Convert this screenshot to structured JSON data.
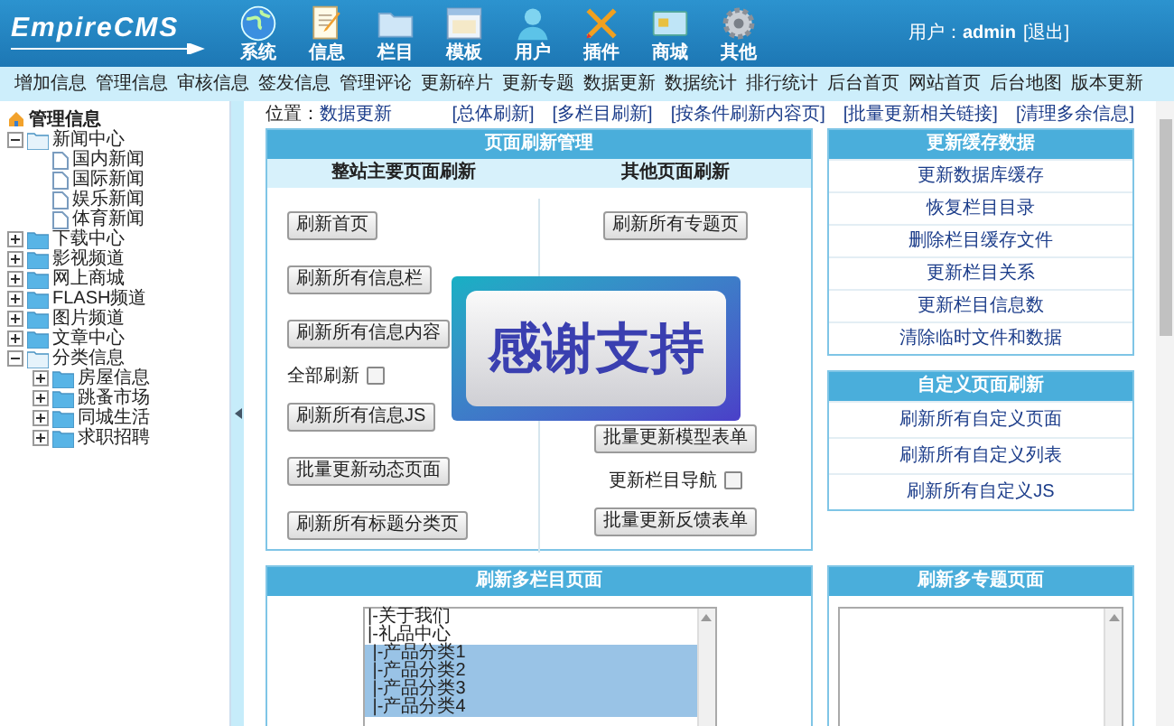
{
  "header": {
    "logo": "EmpireCMS",
    "modules": [
      {
        "label": "系统"
      },
      {
        "label": "信息"
      },
      {
        "label": "栏目"
      },
      {
        "label": "模板"
      },
      {
        "label": "用户"
      },
      {
        "label": "插件"
      },
      {
        "label": "商城"
      },
      {
        "label": "其他"
      }
    ],
    "user_text": "用户：**admin**",
    "logout": "[退出]"
  },
  "nav": [
    "增加信息",
    "管理信息",
    "审核信息",
    "签发信息",
    "管理评论",
    "更新碎片",
    "更新专题",
    "数据更新",
    "数据统计",
    "排行统计",
    "后台首页",
    "网站首页",
    "后台地图",
    "版本更新"
  ],
  "tree": {
    "title": "管理信息",
    "items": [
      {
        "label": "新闻中心",
        "kind": "folder",
        "expanded": true,
        "children": [
          {
            "label": "国内新闻",
            "kind": "page"
          },
          {
            "label": "国际新闻",
            "kind": "page"
          },
          {
            "label": "娱乐新闻",
            "kind": "page"
          },
          {
            "label": "体育新闻",
            "kind": "page"
          }
        ]
      },
      {
        "label": "下载中心",
        "kind": "folder",
        "expanded": false
      },
      {
        "label": "影视频道",
        "kind": "folder",
        "expanded": false
      },
      {
        "label": "网上商城",
        "kind": "folder",
        "expanded": false
      },
      {
        "label": "FLASH频道",
        "kind": "folder",
        "expanded": false
      },
      {
        "label": "图片频道",
        "kind": "folder",
        "expanded": false
      },
      {
        "label": "文章中心",
        "kind": "folder",
        "expanded": false
      },
      {
        "label": "分类信息",
        "kind": "folder",
        "expanded": true,
        "children": [
          {
            "label": "房屋信息",
            "kind": "folder",
            "expanded": false
          },
          {
            "label": "跳蚤市场",
            "kind": "folder",
            "expanded": false
          },
          {
            "label": "同城生活",
            "kind": "folder",
            "expanded": false
          },
          {
            "label": "求职招聘",
            "kind": "folder",
            "expanded": false
          }
        ]
      }
    ]
  },
  "breadcrumb": {
    "label": "位置：",
    "link": "数据更新"
  },
  "quick_links": [
    "[总体刷新]",
    "[多栏目刷新]",
    "[按条件刷新内容页]",
    "[批量更新相关链接]",
    "[清理多余信息]"
  ],
  "refresh_panel": {
    "title": "页面刷新管理",
    "columns": [
      {
        "heading": "整站主要页面刷新",
        "items": [
          {
            "kind": "button",
            "label": "刷新首页"
          },
          {
            "kind": "button",
            "label": "刷新所有信息栏"
          },
          {
            "kind": "button",
            "label": "刷新所有信息内容"
          },
          {
            "kind": "checkbox",
            "label": "全部刷新",
            "checked": false
          },
          {
            "kind": "button",
            "label": "刷新所有信息JS"
          },
          {
            "kind": "button",
            "label": "批量更新动态页面"
          },
          {
            "kind": "button",
            "label": "刷新所有标题分类页"
          }
        ]
      },
      {
        "heading": "其他页面刷新",
        "items": [
          {
            "kind": "button",
            "label": "刷新所有专题页"
          },
          {
            "kind": "covered"
          },
          {
            "kind": "button",
            "label": "批量更新模型表单"
          },
          {
            "kind": "checkbox",
            "label": "更新栏目导航",
            "checked": false
          },
          {
            "kind": "button",
            "label": "批量更新反馈表单"
          }
        ]
      }
    ]
  },
  "cache_panel": {
    "title": "更新缓存数据",
    "links": [
      "更新数据库缓存",
      "恢复栏目目录",
      "删除栏目缓存文件",
      "更新栏目关系",
      "更新栏目信息数",
      "清除临时文件和数据"
    ]
  },
  "custom_panel": {
    "title": "自定义页面刷新",
    "links": [
      "刷新所有自定义页面",
      "刷新所有自定义列表",
      "刷新所有自定义JS"
    ]
  },
  "multi_column_panel": {
    "title": "刷新多栏目页面",
    "options": [
      {
        "label": "|-关于我们",
        "selected": false
      },
      {
        "label": "|-礼品中心",
        "selected": false
      },
      {
        "label": " |-产品分类1",
        "selected": true
      },
      {
        "label": " |-产品分类2",
        "selected": true
      },
      {
        "label": " |-产品分类3",
        "selected": true
      },
      {
        "label": " |-产品分类4",
        "selected": true
      }
    ]
  },
  "multi_topic_panel": {
    "title": "刷新多专题页面"
  },
  "overlay": {
    "text": "感谢支持"
  }
}
